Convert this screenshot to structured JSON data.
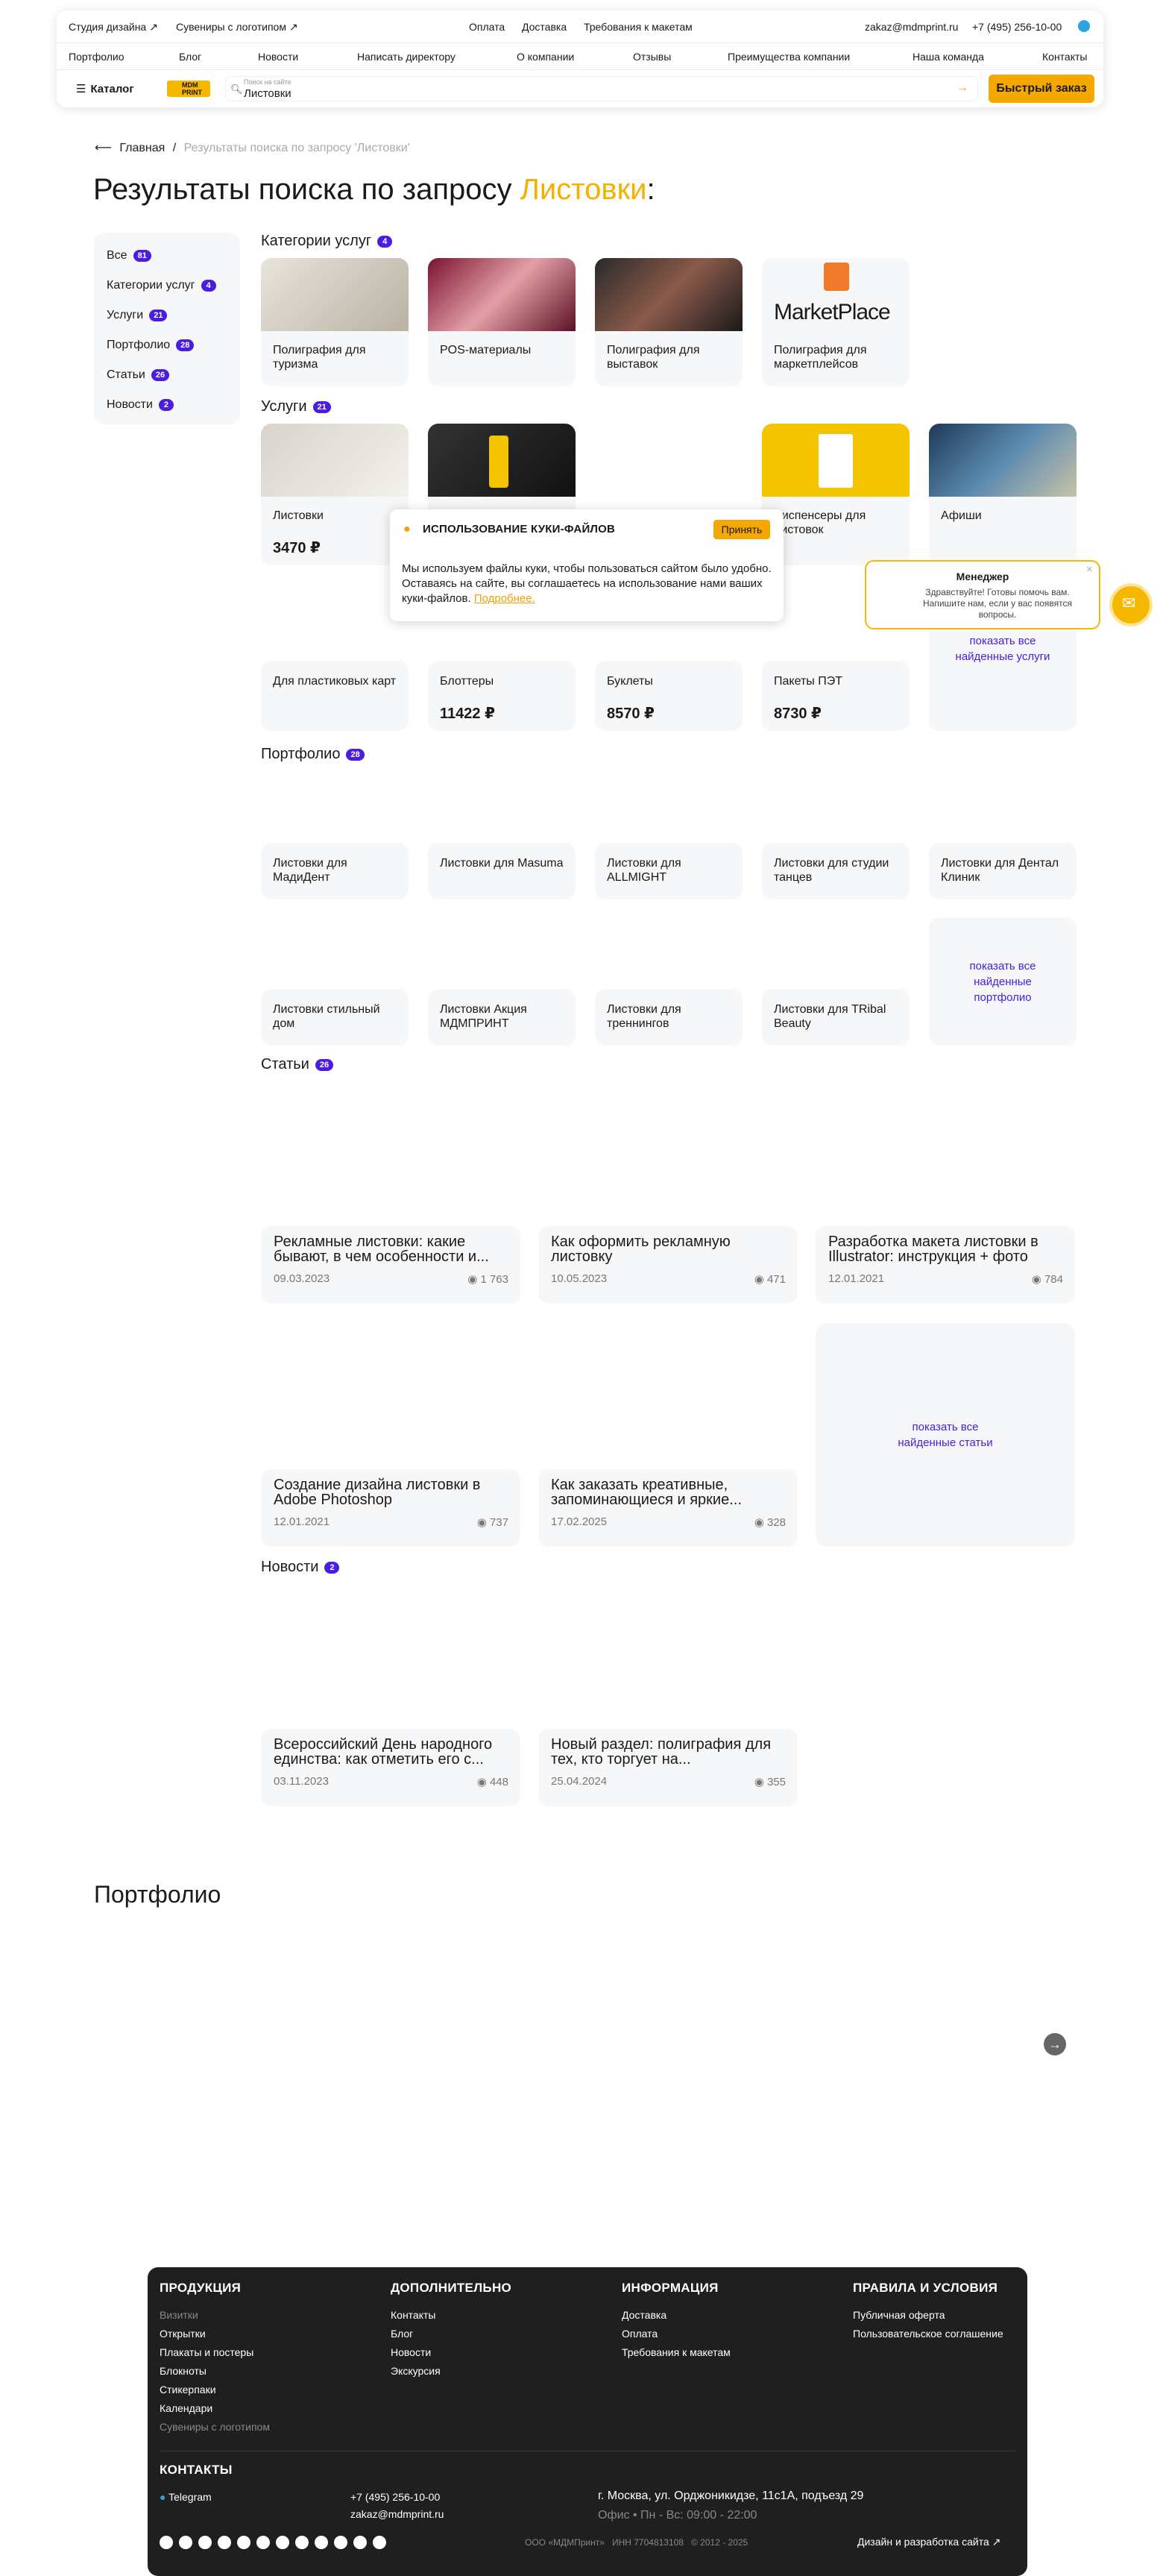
{
  "header": {
    "top_left": [
      "Студия дизайна ↗",
      "Сувениры с логотипом ↗"
    ],
    "top_center": [
      "Оплата",
      "Доставка",
      "Требования к макетам"
    ],
    "email": "zakaz@mdmprint.ru",
    "phone": "+7 (495) 256-10-00",
    "nav": [
      "Портфолио",
      "Блог",
      "Новости",
      "Написать директору",
      "О компании",
      "Отзывы",
      "Преимущества компании",
      "Наша команда",
      "Контакты"
    ],
    "catalog_label": "Каталог",
    "logo_text": "MDM PRINT",
    "search_placeholder": "Поиск на сайте",
    "search_value": "Листовки",
    "fast_order": "Быстрый заказ"
  },
  "breadcrumb": {
    "home": "Главная",
    "separator": "/",
    "current": "Результаты поиска по запросу 'Листовки'"
  },
  "title": {
    "prefix": "Результаты поиска по запросу",
    "query": "Листовки",
    "suffix": ":"
  },
  "sidebar": [
    {
      "label": "Все",
      "count": "81"
    },
    {
      "label": "Категории услуг",
      "count": "4"
    },
    {
      "label": "Услуги",
      "count": "21"
    },
    {
      "label": "Портфолио",
      "count": "28"
    },
    {
      "label": "Статьи",
      "count": "26"
    },
    {
      "label": "Новости",
      "count": "2"
    }
  ],
  "sections": {
    "categories": {
      "title": "Категории услуг",
      "count": "4",
      "items": [
        "Полиграфия для туризма",
        "POS-материалы",
        "Полиграфия для выставок",
        "Полиграфия для маркетплейсов"
      ]
    },
    "services": {
      "title": "Услуги",
      "count": "21",
      "row1": [
        {
          "title": "Листовки",
          "price": "3470 ₽"
        },
        {
          "title": "",
          "price": ""
        },
        {
          "title": "",
          "price": ""
        },
        {
          "title": "Диспенсеры для листовок",
          "price": ""
        },
        {
          "title": "Афиши",
          "price": ""
        }
      ],
      "row2": [
        {
          "title": "Для пластиковых карт",
          "price": ""
        },
        {
          "title": "Блоттеры",
          "price": "11422 ₽"
        },
        {
          "title": "Буклеты",
          "price": "8570 ₽"
        },
        {
          "title": "Пакеты ПЭТ",
          "price": "8730 ₽"
        }
      ],
      "show_all": "показать все найденные услуги"
    },
    "portfolio": {
      "title": "Портфолио",
      "count": "28",
      "row1": [
        "Листовки для МадиДент",
        "Листовки для Masuma",
        "Листовки для ALLMIGHT",
        "Листовки для студии танцев",
        "Листовки для Дентал Клиник"
      ],
      "row2": [
        "Листовки стильный дом",
        "Листовки Акция МДМПРИНТ",
        "Листовки для треннингов",
        "Листовки для TRibal Beauty"
      ],
      "show_all": "показать все найденные портфолио"
    },
    "articles": {
      "title": "Статьи",
      "count": "26",
      "items": [
        {
          "title": "Рекламные листовки: какие бывают, в чем особенности и...",
          "date": "09.03.2023",
          "views": "1 763"
        },
        {
          "title": "Как оформить рекламную листовку",
          "date": "10.05.2023",
          "views": "471"
        },
        {
          "title": "Разработка макета листовки в Illustrator: инструкция + фото",
          "date": "12.01.2021",
          "views": "784"
        },
        {
          "title": "Создание дизайна листовки в Adobe Photoshop",
          "date": "12.01.2021",
          "views": "737"
        },
        {
          "title": "Как заказать креативные, запоминающиеся и яркие...",
          "date": "17.02.2025",
          "views": "328"
        }
      ],
      "show_all": "показать все найденные статьи"
    },
    "news": {
      "title": "Новости",
      "count": "2",
      "items": [
        {
          "title": "Всероссийский День народного единства: как отметить его с...",
          "date": "03.11.2023",
          "views": "448"
        },
        {
          "title": "Новый раздел: полиграфия для тех, кто торгует на...",
          "date": "25.04.2024",
          "views": "355"
        }
      ]
    }
  },
  "portfolio_block": {
    "title": "Портфолио"
  },
  "cookie": {
    "title": "ИСПОЛЬЗОВАНИЕ КУКИ-ФАЙЛОВ",
    "accept": "Принять",
    "text": "Мы используем файлы куки, чтобы пользоваться сайтом было удобно. Оставаясь на сайте, вы соглашаетесь на использование нами ваших куки-файлов.",
    "link": "Подробнее."
  },
  "manager": {
    "title": "Менеджер",
    "text": "Здравствуйте! Готовы помочь вам. Напишите нам, если у вас появятся вопросы."
  },
  "footer": {
    "col1": {
      "title": "ПРОДУКЦИЯ",
      "items": [
        "Визитки",
        "Открытки",
        "Плакаты и постеры",
        "Блокноты",
        "Стикерпаки",
        "Календари",
        "Сувениры с логотипом"
      ]
    },
    "col2": {
      "title": "ДОПОЛНИТЕЛЬНО",
      "items": [
        "Контакты",
        "Блог",
        "Новости",
        "Экскурсия"
      ]
    },
    "col3": {
      "title": "ИНФОРМАЦИЯ",
      "items": [
        "Доставка",
        "Оплата",
        "Требования к макетам"
      ]
    },
    "col4": {
      "title": "ПРАВИЛА И УСЛОВИЯ",
      "items": [
        "Публичная оферта",
        "Пользовательское соглашение"
      ]
    },
    "contacts_title": "КОНТАКТЫ",
    "telegram": "Telegram",
    "phone": "+7 (495) 256-10-00",
    "email": "zakaz@mdmprint.ru",
    "address": "г. Москва, ул. Орджоникидзе, 11с1А, подъезд 29",
    "hours": "Офис • Пн - Вс: 09:00 - 22:00",
    "company": "ООО «МДМПринт»",
    "inn": "ИНН 7704813108",
    "years": "© 2012 - 2025",
    "dev": "Дизайн и разработка сайта ↗"
  },
  "colors": {
    "accent": "#f5b000",
    "brand_purple": "#4a1de0",
    "footer_bg": "#1f1f1f"
  }
}
